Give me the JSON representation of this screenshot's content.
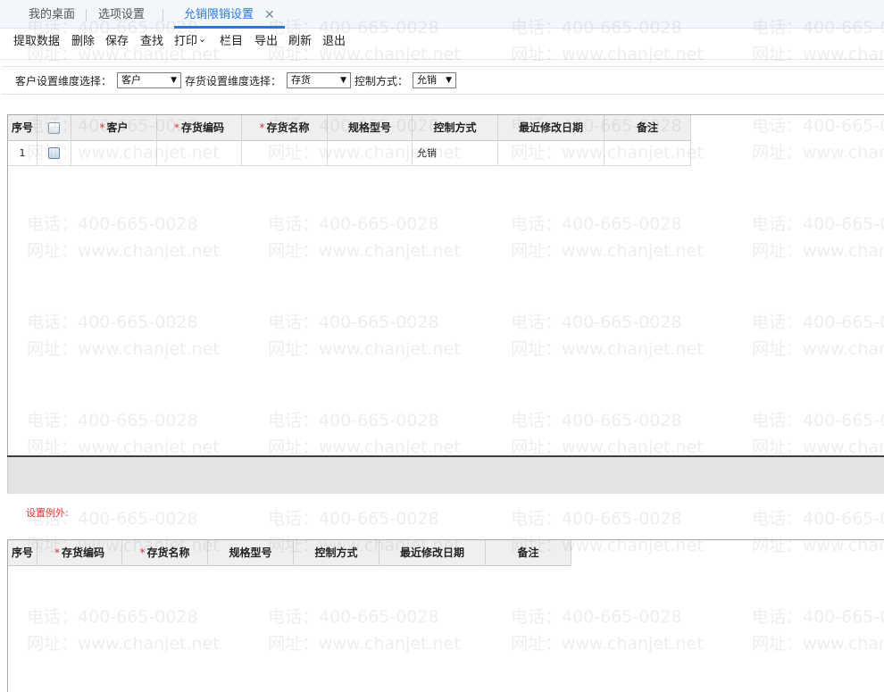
{
  "tabs": [
    {
      "label": "我的桌面"
    },
    {
      "label": "选项设置"
    },
    {
      "label": "允销限销设置",
      "active": true
    }
  ],
  "tab_close": "✕",
  "toolbar": {
    "buttons": [
      "提取数据",
      "删除",
      "保存",
      "查找",
      "打印",
      "栏目",
      "导出",
      "刷新",
      "退出"
    ],
    "print_chevron": "⌄"
  },
  "filters": {
    "customer_label": "客户设置维度选择：",
    "customer_value": "客户",
    "inventory_label": "存货设置维度选择：",
    "inventory_value": "存货",
    "control_label": "控制方式：",
    "control_value": "允销",
    "arrow": "▼"
  },
  "grid1": {
    "required_mark": "*",
    "headers": [
      "序号",
      "",
      "客户",
      "存货编码",
      "存货名称",
      "规格型号",
      "控制方式",
      "最近修改日期",
      "备注"
    ],
    "rows": [
      {
        "seq": "1",
        "customer": "",
        "code": "",
        "name": "",
        "spec": "",
        "control": "允销",
        "date": "",
        "note": ""
      }
    ]
  },
  "exception_label": "设置例外:",
  "grid2": {
    "required_mark": "*",
    "headers": [
      "序号",
      "存货编码",
      "存货名称",
      "规格型号",
      "控制方式",
      "最近修改日期",
      "备注"
    ]
  },
  "watermark": {
    "phone": "电话：400-665-0028",
    "site": "网址：www.chanjet.net"
  },
  "colors": {
    "accent": "#2a78d8",
    "required": "#e23434",
    "header_bg": "#efefef",
    "footer_bg": "#e3e3e3"
  }
}
